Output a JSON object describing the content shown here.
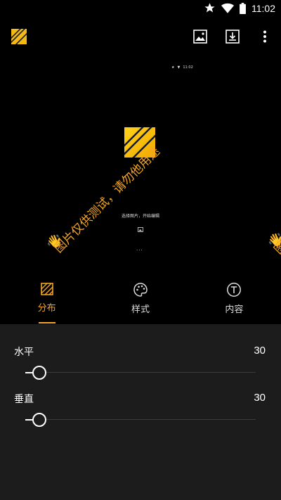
{
  "status_bar": {
    "time": "11:02",
    "icons": [
      "star-icon",
      "wifi-icon",
      "battery-icon"
    ]
  },
  "appbar": {
    "actions": [
      "image-icon",
      "download-icon",
      "more-vert-icon"
    ]
  },
  "preview": {
    "mini_time": "11:02",
    "mini_caption": "选择图片，开始编辑",
    "mini_dots": "...",
    "watermark_text": "图片仅供测试，请勿他用途",
    "watermark_text_clip": "图",
    "watermark_emoji": "👋"
  },
  "tabs": [
    {
      "label": "分布",
      "icon": "texture-icon",
      "active": true
    },
    {
      "label": "样式",
      "icon": "palette-icon",
      "active": false
    },
    {
      "label": "内容",
      "icon": "text-icon",
      "active": false
    }
  ],
  "settings": {
    "horizontal": {
      "label": "水平",
      "value": "30",
      "fraction": 0.06
    },
    "vertical": {
      "label": "垂直",
      "value": "30",
      "fraction": 0.06
    }
  },
  "colors": {
    "accent": "#f5a623",
    "panel_bg": "#1c1c1c",
    "background": "#000000"
  }
}
